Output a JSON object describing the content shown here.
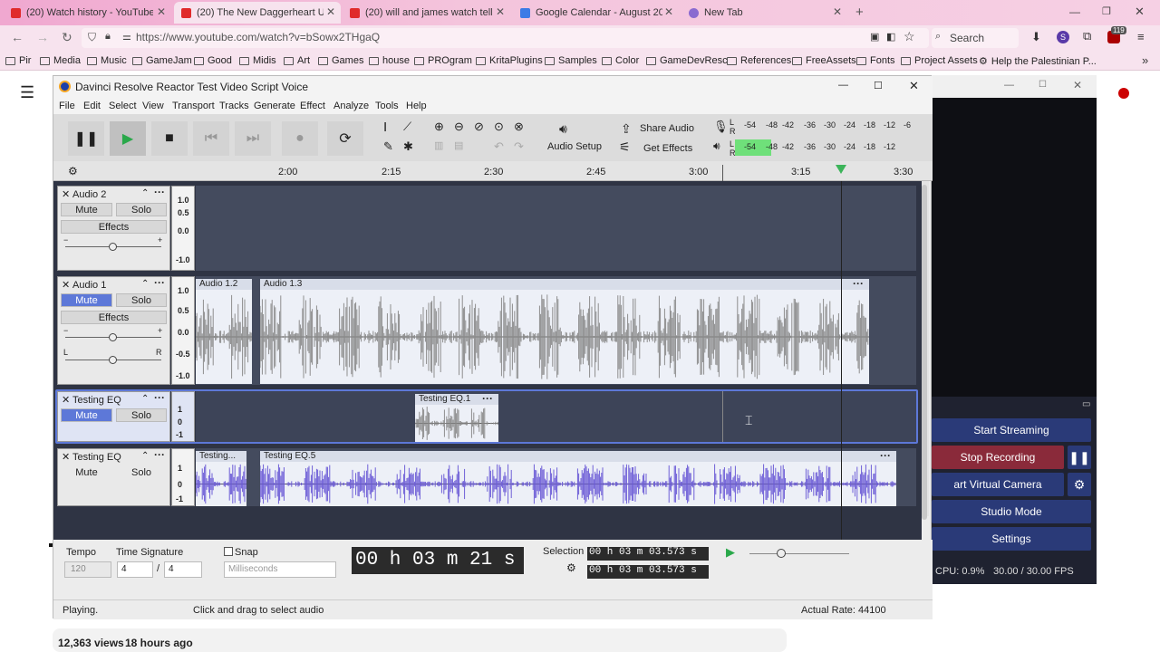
{
  "browser": {
    "tabs": [
      {
        "label": "(20) Watch history - YouTube",
        "color": "#e02b2b"
      },
      {
        "label": "(20) The New Daggerheart Upd",
        "color": "#e02b2b"
      },
      {
        "label": "(20) will and james watch telly",
        "color": "#e02b2b"
      },
      {
        "label": "Google Calendar - August 2025",
        "color": "#3c7be6"
      },
      {
        "label": "New Tab",
        "color": "#8a6ad0"
      }
    ],
    "new_tab": "+",
    "url": "https://www.youtube.com/watch?v=bSowx2THgaQ",
    "search_placeholder": "Search",
    "ext_badge": "119",
    "profile_initial": "S",
    "bookmarks": [
      "Pir",
      "Media",
      "Music",
      "GameJam",
      "Good",
      "Midis",
      "Art",
      "Games",
      "house",
      "PROgram",
      "KritaPlugins",
      "Samples",
      "Color",
      "GameDevResc",
      "References",
      "FreeAssets",
      "Fonts",
      "Project Assets",
      "Help the Palestinian P..."
    ]
  },
  "audacity": {
    "title": "Davinci Resolve Reactor Test Video Script Voice",
    "menu": [
      "File",
      "Edit",
      "Select",
      "View",
      "Transport",
      "Tracks",
      "Generate",
      "Effect",
      "Analyze",
      "Tools",
      "Help"
    ],
    "audio_setup": "Audio Setup",
    "share_audio": "Share Audio",
    "get_effects": "Get Effects",
    "meter_ticks": [
      "-54",
      "-48",
      "-42",
      "-36",
      "-30",
      "-24",
      "-18",
      "-12",
      "-6",
      "0"
    ],
    "meter_rec_l": "L",
    "meter_rec_r": "R",
    "ruler": [
      "2:00",
      "2:15",
      "2:30",
      "2:45",
      "3:00",
      "3:15",
      "3:30"
    ],
    "tracks": [
      {
        "name": "Audio 2",
        "mute": "Mute",
        "solo": "Solo",
        "effects": "Effects",
        "scale": [
          "1.0",
          "0.5",
          "0.0",
          "-1.0"
        ],
        "muted": false
      },
      {
        "name": "Audio 1",
        "mute": "Mute",
        "solo": "Solo",
        "effects": "Effects",
        "scale": [
          "1.0",
          "0.5",
          "0.0",
          "-0.5",
          "-1.0"
        ],
        "muted": true,
        "clips": [
          "Audio 1.2",
          "Audio 1.3"
        ],
        "pan_l": "L",
        "pan_r": "R"
      },
      {
        "name": "Testing EQ",
        "mute": "Mute",
        "solo": "Solo",
        "scale": [
          "1",
          "0",
          "-1"
        ],
        "muted": true,
        "clips": [
          "Testing EQ.1"
        ]
      },
      {
        "name": "Testing EQ",
        "mute": "Mute",
        "solo": "Solo",
        "scale": [
          "1",
          "0",
          "-1"
        ],
        "muted": false,
        "clips": [
          "Testing...",
          "Testing EQ.5"
        ]
      }
    ],
    "tempo_label": "Tempo",
    "tempo": "120",
    "time_sig_label": "Time Signature",
    "time_sig_num": "4",
    "time_sig_den": "4",
    "time_sig_sep": "/",
    "snap_label": "Snap",
    "snap_unit": "Milliseconds",
    "time": "00 h 03 m 21 s",
    "selection_label": "Selection",
    "sel_start": "00 h 03 m 03.573 s",
    "sel_end": "00 h 03 m 03.573 s",
    "status_left": "Playing.",
    "status_mid": "Click and drag to select audio",
    "status_right": "Actual Rate: 44100"
  },
  "obs": {
    "buttons": [
      "Start Streaming",
      "Stop Recording",
      "art Virtual Camera",
      "Studio Mode",
      "Settings"
    ],
    "cpu": "CPU: 0.9%",
    "fps": "30.00 / 30.00 FPS"
  },
  "youtube": {
    "views": "12,363 views",
    "age": "18 hours ago"
  }
}
